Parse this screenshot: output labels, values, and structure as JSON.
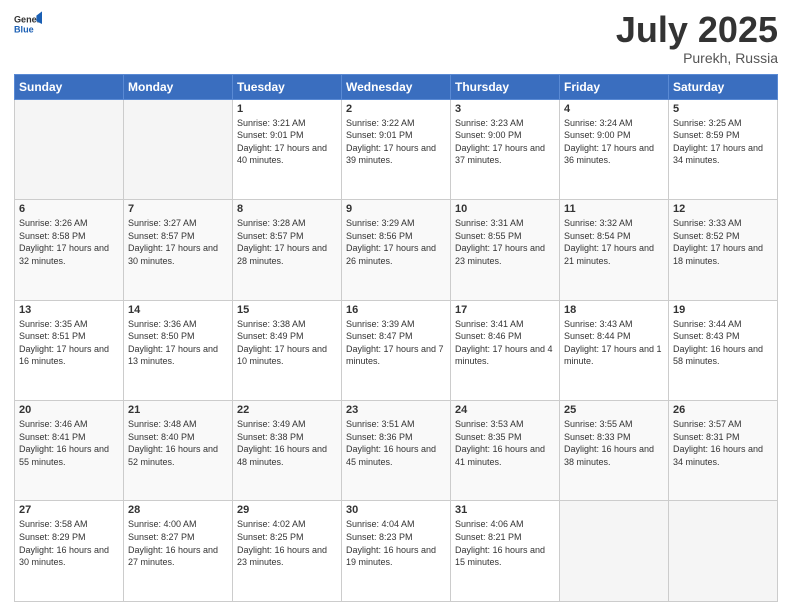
{
  "header": {
    "logo_general": "General",
    "logo_blue": "Blue",
    "month": "July 2025",
    "location": "Purekh, Russia"
  },
  "weekdays": [
    "Sunday",
    "Monday",
    "Tuesday",
    "Wednesday",
    "Thursday",
    "Friday",
    "Saturday"
  ],
  "weeks": [
    [
      {
        "day": "",
        "empty": true
      },
      {
        "day": "",
        "empty": true
      },
      {
        "day": "1",
        "sunrise": "3:21 AM",
        "sunset": "9:01 PM",
        "daylight": "17 hours and 40 minutes."
      },
      {
        "day": "2",
        "sunrise": "3:22 AM",
        "sunset": "9:01 PM",
        "daylight": "17 hours and 39 minutes."
      },
      {
        "day": "3",
        "sunrise": "3:23 AM",
        "sunset": "9:00 PM",
        "daylight": "17 hours and 37 minutes."
      },
      {
        "day": "4",
        "sunrise": "3:24 AM",
        "sunset": "9:00 PM",
        "daylight": "17 hours and 36 minutes."
      },
      {
        "day": "5",
        "sunrise": "3:25 AM",
        "sunset": "8:59 PM",
        "daylight": "17 hours and 34 minutes."
      }
    ],
    [
      {
        "day": "6",
        "sunrise": "3:26 AM",
        "sunset": "8:58 PM",
        "daylight": "17 hours and 32 minutes."
      },
      {
        "day": "7",
        "sunrise": "3:27 AM",
        "sunset": "8:57 PM",
        "daylight": "17 hours and 30 minutes."
      },
      {
        "day": "8",
        "sunrise": "3:28 AM",
        "sunset": "8:57 PM",
        "daylight": "17 hours and 28 minutes."
      },
      {
        "day": "9",
        "sunrise": "3:29 AM",
        "sunset": "8:56 PM",
        "daylight": "17 hours and 26 minutes."
      },
      {
        "day": "10",
        "sunrise": "3:31 AM",
        "sunset": "8:55 PM",
        "daylight": "17 hours and 23 minutes."
      },
      {
        "day": "11",
        "sunrise": "3:32 AM",
        "sunset": "8:54 PM",
        "daylight": "17 hours and 21 minutes."
      },
      {
        "day": "12",
        "sunrise": "3:33 AM",
        "sunset": "8:52 PM",
        "daylight": "17 hours and 18 minutes."
      }
    ],
    [
      {
        "day": "13",
        "sunrise": "3:35 AM",
        "sunset": "8:51 PM",
        "daylight": "17 hours and 16 minutes."
      },
      {
        "day": "14",
        "sunrise": "3:36 AM",
        "sunset": "8:50 PM",
        "daylight": "17 hours and 13 minutes."
      },
      {
        "day": "15",
        "sunrise": "3:38 AM",
        "sunset": "8:49 PM",
        "daylight": "17 hours and 10 minutes."
      },
      {
        "day": "16",
        "sunrise": "3:39 AM",
        "sunset": "8:47 PM",
        "daylight": "17 hours and 7 minutes."
      },
      {
        "day": "17",
        "sunrise": "3:41 AM",
        "sunset": "8:46 PM",
        "daylight": "17 hours and 4 minutes."
      },
      {
        "day": "18",
        "sunrise": "3:43 AM",
        "sunset": "8:44 PM",
        "daylight": "17 hours and 1 minute."
      },
      {
        "day": "19",
        "sunrise": "3:44 AM",
        "sunset": "8:43 PM",
        "daylight": "16 hours and 58 minutes."
      }
    ],
    [
      {
        "day": "20",
        "sunrise": "3:46 AM",
        "sunset": "8:41 PM",
        "daylight": "16 hours and 55 minutes."
      },
      {
        "day": "21",
        "sunrise": "3:48 AM",
        "sunset": "8:40 PM",
        "daylight": "16 hours and 52 minutes."
      },
      {
        "day": "22",
        "sunrise": "3:49 AM",
        "sunset": "8:38 PM",
        "daylight": "16 hours and 48 minutes."
      },
      {
        "day": "23",
        "sunrise": "3:51 AM",
        "sunset": "8:36 PM",
        "daylight": "16 hours and 45 minutes."
      },
      {
        "day": "24",
        "sunrise": "3:53 AM",
        "sunset": "8:35 PM",
        "daylight": "16 hours and 41 minutes."
      },
      {
        "day": "25",
        "sunrise": "3:55 AM",
        "sunset": "8:33 PM",
        "daylight": "16 hours and 38 minutes."
      },
      {
        "day": "26",
        "sunrise": "3:57 AM",
        "sunset": "8:31 PM",
        "daylight": "16 hours and 34 minutes."
      }
    ],
    [
      {
        "day": "27",
        "sunrise": "3:58 AM",
        "sunset": "8:29 PM",
        "daylight": "16 hours and 30 minutes."
      },
      {
        "day": "28",
        "sunrise": "4:00 AM",
        "sunset": "8:27 PM",
        "daylight": "16 hours and 27 minutes."
      },
      {
        "day": "29",
        "sunrise": "4:02 AM",
        "sunset": "8:25 PM",
        "daylight": "16 hours and 23 minutes."
      },
      {
        "day": "30",
        "sunrise": "4:04 AM",
        "sunset": "8:23 PM",
        "daylight": "16 hours and 19 minutes."
      },
      {
        "day": "31",
        "sunrise": "4:06 AM",
        "sunset": "8:21 PM",
        "daylight": "16 hours and 15 minutes."
      },
      {
        "day": "",
        "empty": true
      },
      {
        "day": "",
        "empty": true
      }
    ]
  ]
}
